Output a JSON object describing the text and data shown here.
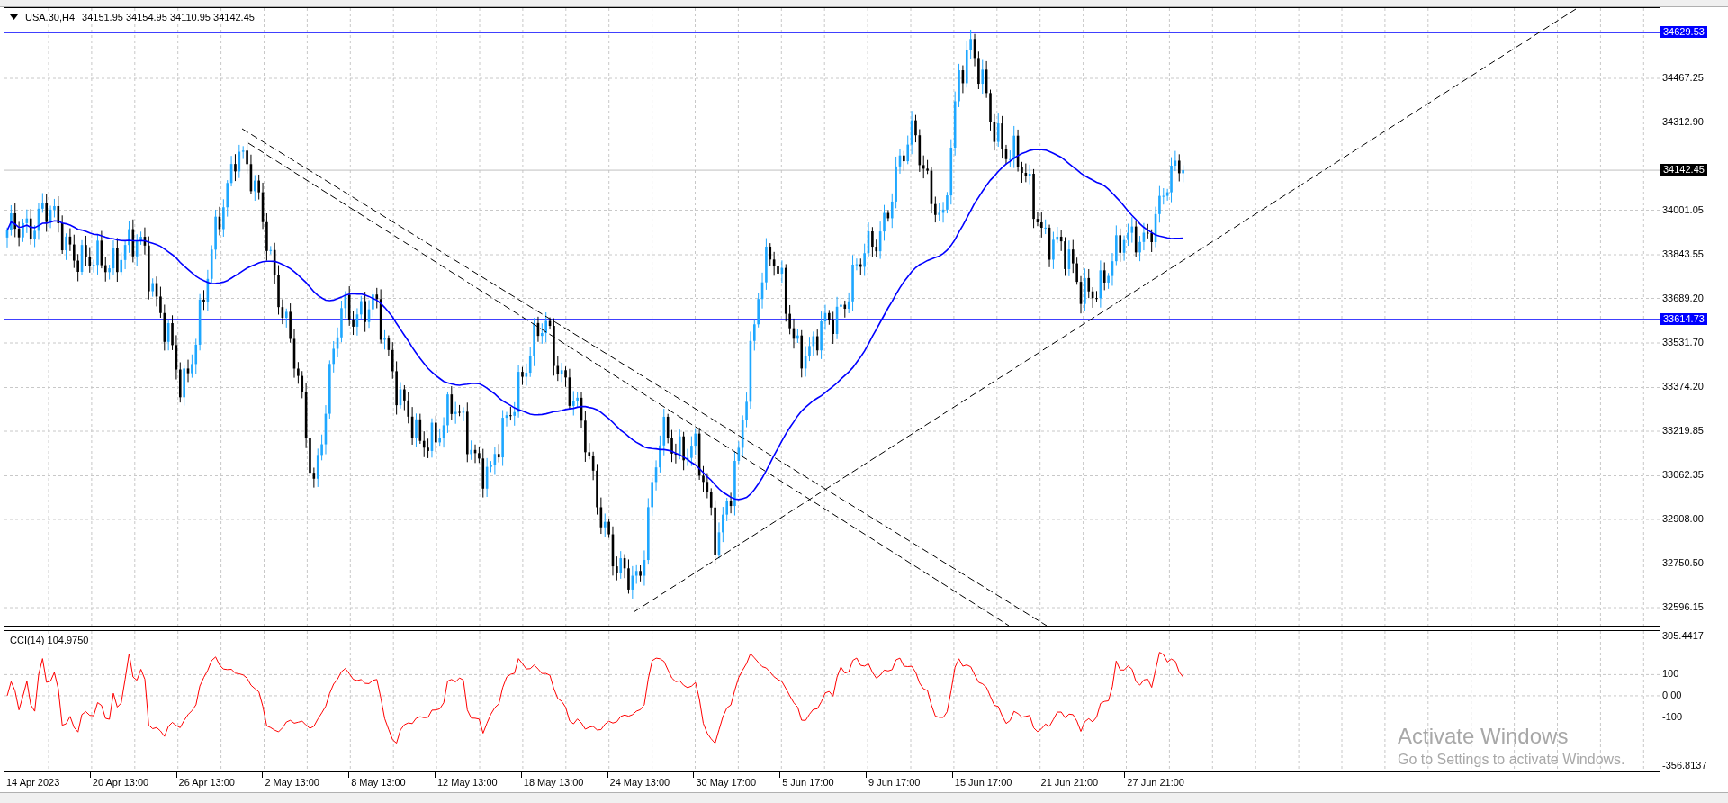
{
  "chart": {
    "symbol": "USA.30,H4",
    "ohlc": "34151.95 34154.95 34110.95 34142.45",
    "price_ticks": [
      "34467.25",
      "34312.90",
      "34001.05",
      "33843.55",
      "33689.20",
      "33531.70",
      "33374.20",
      "33219.85",
      "33062.35",
      "32908.00",
      "32750.50",
      "32596.15"
    ],
    "price_markers": [
      {
        "kind": "line",
        "label": "34629.53"
      },
      {
        "kind": "current",
        "label": "34142.45"
      },
      {
        "kind": "line",
        "label": "33614.73"
      }
    ]
  },
  "indicator": {
    "title": "CCI(14) 104.9750",
    "ticks": [
      "305.4417",
      "100",
      "0.00",
      "-100",
      "-356.8137"
    ]
  },
  "time_axis": [
    "14 Apr 2023",
    "20 Apr 13:00",
    "26 Apr 13:00",
    "2 May 13:00",
    "8 May 13:00",
    "12 May 13:00",
    "18 May 13:00",
    "24 May 13:00",
    "30 May 17:00",
    "5 Jun 17:00",
    "9 Jun 17:00",
    "15 Jun 17:00",
    "21 Jun 21:00",
    "27 Jun 21:00"
  ],
  "overlay": {
    "title": "Activate Windows",
    "subtitle": "Go to Settings to activate Windows."
  }
}
